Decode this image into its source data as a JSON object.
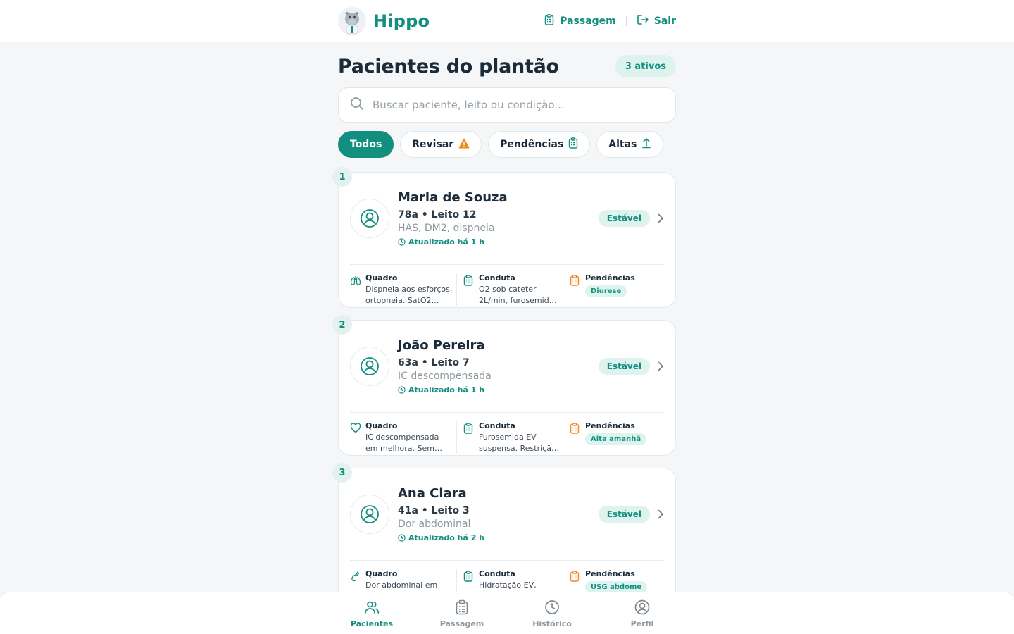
{
  "header": {
    "brand": "Hippo",
    "links": [
      {
        "label": "Passagem",
        "icon": "clipboard-icon"
      },
      {
        "label": "Sair",
        "icon": "logout-icon"
      }
    ]
  },
  "page": {
    "title": "Pacientes do plantão",
    "active_count": "3 ativos"
  },
  "search": {
    "placeholder": "Buscar paciente, leito ou condição..."
  },
  "filters": [
    {
      "label": "Todos",
      "active": true
    },
    {
      "label": "Revisar",
      "icon": "warning-icon"
    },
    {
      "label": "Pendências",
      "icon": "clipboard-icon"
    },
    {
      "label": "Altas",
      "icon": "arrow-up-icon"
    }
  ],
  "patients": [
    {
      "index": "1",
      "name": "Maria de Souza",
      "meta": "78a • Leito 12",
      "conditions": "HAS, DM2, dispneia",
      "updated": "Atualizado há 1 h",
      "status": "Estável",
      "quadro_label": "Quadro",
      "quadro_icon": "lungs-icon",
      "quadro": "Dispneia aos esforços, ortopneia. SatO2…",
      "conduta_label": "Conduta",
      "conduta": "O2 sob cateter 2L/min, furosemid…",
      "pendencias_label": "Pendências",
      "pendencia": "Diurese"
    },
    {
      "index": "2",
      "name": "João Pereira",
      "meta": "63a • Leito 7",
      "conditions": "IC descompensada",
      "updated": "Atualizado há 1 h",
      "status": "Estável",
      "quadro_label": "Quadro",
      "quadro_icon": "heart-icon",
      "quadro": "IC descompensada em melhora. Sem…",
      "conduta_label": "Conduta",
      "conduta": "Furosemida EV suspensa. Restriçã…",
      "pendencias_label": "Pendências",
      "pendencia": "Alta amanhã"
    },
    {
      "index": "3",
      "name": "Ana Clara",
      "meta": "41a • Leito 3",
      "conditions": "Dor abdominal",
      "updated": "Atualizado há 2 h",
      "status": "Estável",
      "quadro_label": "Quadro",
      "quadro_icon": "intestine-icon",
      "quadro": "Dor abdominal em FID, náuseas.",
      "conduta_label": "Conduta",
      "conduta": "Hidratação EV, analgesia.",
      "pendencias_label": "Pendências",
      "pendencia": "USG abdome"
    }
  ],
  "bottom_nav": [
    {
      "label": "Pacientes",
      "icon": "users-icon",
      "active": true
    },
    {
      "label": "Passagem",
      "icon": "clipboard-icon"
    },
    {
      "label": "Histórico",
      "icon": "clock-icon"
    },
    {
      "label": "Perfil",
      "icon": "user-circle-icon"
    }
  ],
  "colors": {
    "accent": "#138f7f",
    "accent_soft": "#dff3ee",
    "warning": "#f08a1c",
    "background": "#f4f6f7"
  }
}
